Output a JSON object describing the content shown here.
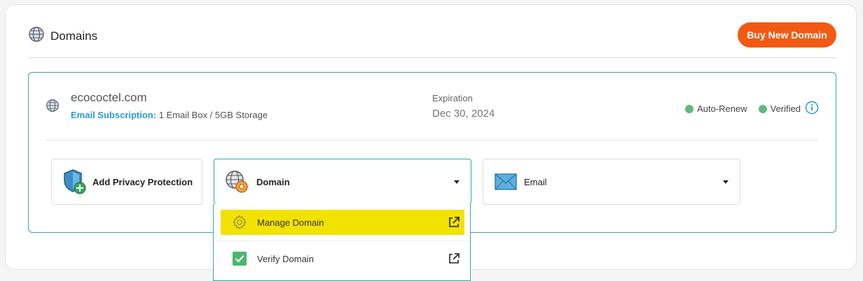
{
  "header": {
    "title": "Domains",
    "buy_button_label": "Buy New Domain"
  },
  "domain_card": {
    "domain_name": "ecococtel.com",
    "email_subscription_label": "Email Subscription:",
    "email_subscription_value": "1 Email Box / 5GB Storage",
    "expiration_label": "Expiration",
    "expiration_value": "Dec 30, 2024",
    "statuses": [
      {
        "label": "Auto-Renew",
        "color": "#5bbd7a"
      },
      {
        "label": "Verified",
        "color": "#5bbd7a"
      }
    ]
  },
  "options": {
    "privacy_label": "Add Privacy Protection",
    "domain_label": "Domain",
    "email_label": "Email"
  },
  "dropdown": {
    "items": [
      {
        "label": "Manage Domain",
        "icon": "gear-icon",
        "highlighted": true
      },
      {
        "label": "Verify Domain",
        "icon": "checkbox-icon",
        "highlighted": false
      }
    ]
  },
  "colors": {
    "accent_orange": "#f25a14",
    "teal_border": "#3aa79a",
    "link_blue": "#2b9bd0",
    "status_green": "#5bbd7a",
    "highlight_yellow": "#f2e200"
  }
}
